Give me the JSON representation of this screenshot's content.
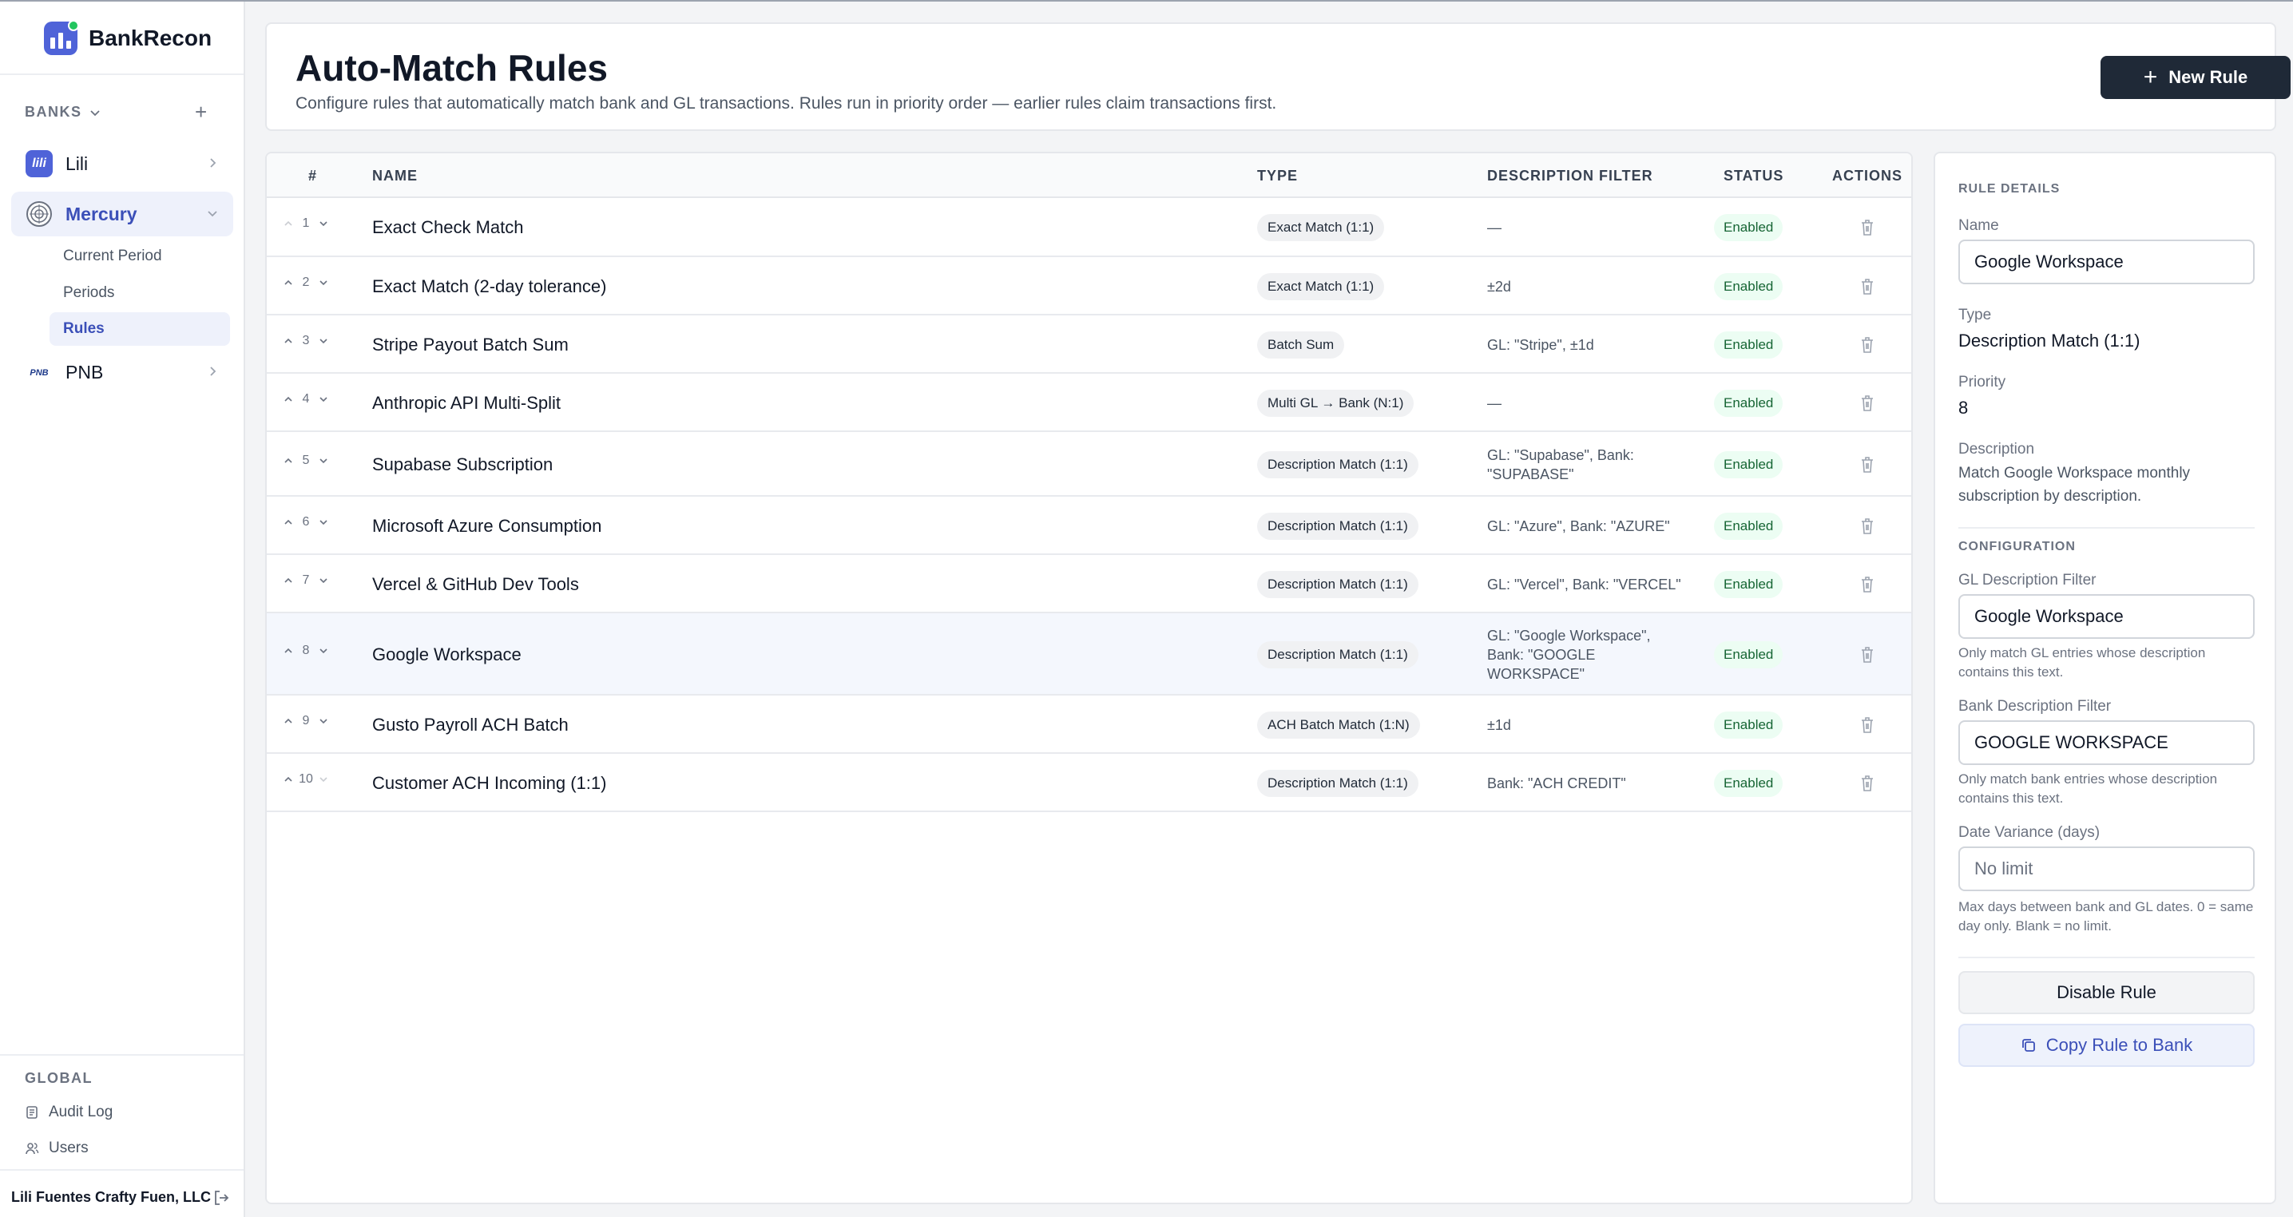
{
  "app": {
    "name": "BankRecon"
  },
  "sidebar": {
    "banks_label": "BANKS",
    "banks": [
      {
        "label": "Lili",
        "icon": "lili-logo-icon",
        "color": "#4f63d8"
      },
      {
        "label": "Mercury",
        "icon": "mercury-logo-icon",
        "color": "#6b7280"
      },
      {
        "label": "PNB",
        "icon": "pnb-logo-icon",
        "color": "#1e3a8a"
      }
    ],
    "mercury_items": [
      "Current Period",
      "Periods",
      "Rules"
    ],
    "global_label": "GLOBAL",
    "global_items": [
      "Audit Log",
      "Users"
    ],
    "org_name": "Lili Fuentes Crafty Fuen, LLC"
  },
  "header": {
    "title": "Auto-Match Rules",
    "subtitle": "Configure rules that automatically match bank and GL transactions. Rules run in priority order — earlier rules claim transactions first.",
    "new_rule_label": "New Rule"
  },
  "table": {
    "columns": {
      "num": "#",
      "name": "NAME",
      "type": "TYPE",
      "filter": "DESCRIPTION FILTER",
      "status": "STATUS",
      "actions": "ACTIONS"
    },
    "rows": [
      {
        "num": "1",
        "name": "Exact Check Match",
        "type": "Exact Match (1:1)",
        "filter": "—",
        "status": "Enabled"
      },
      {
        "num": "2",
        "name": "Exact Match (2-day tolerance)",
        "type": "Exact Match (1:1)",
        "filter": "±2d",
        "status": "Enabled"
      },
      {
        "num": "3",
        "name": "Stripe Payout Batch Sum",
        "type": "Batch Sum",
        "filter": "GL: \"Stripe\", ±1d",
        "status": "Enabled"
      },
      {
        "num": "4",
        "name": "Anthropic API Multi-Split",
        "type": "Multi GL → Bank (N:1)",
        "filter": "—",
        "status": "Enabled"
      },
      {
        "num": "5",
        "name": "Supabase Subscription",
        "type": "Description Match (1:1)",
        "filter": "GL: \"Supabase\", Bank: \"SUPABASE\"",
        "status": "Enabled"
      },
      {
        "num": "6",
        "name": "Microsoft Azure Consumption",
        "type": "Description Match (1:1)",
        "filter": "GL: \"Azure\", Bank: \"AZURE\"",
        "status": "Enabled"
      },
      {
        "num": "7",
        "name": "Vercel & GitHub Dev Tools",
        "type": "Description Match (1:1)",
        "filter": "GL: \"Vercel\", Bank: \"VERCEL\"",
        "status": "Enabled"
      },
      {
        "num": "8",
        "name": "Google Workspace",
        "type": "Description Match (1:1)",
        "filter": "GL: \"Google Workspace\", Bank: \"GOOGLE WORKSPACE\"",
        "status": "Enabled"
      },
      {
        "num": "9",
        "name": "Gusto Payroll ACH Batch",
        "type": "ACH Batch Match (1:N)",
        "filter": "±1d",
        "status": "Enabled"
      },
      {
        "num": "10",
        "name": "Customer ACH Incoming (1:1)",
        "type": "Description Match (1:1)",
        "filter": "Bank: \"ACH CREDIT\"",
        "status": "Enabled"
      }
    ]
  },
  "details": {
    "section_title": "RULE DETAILS",
    "name_label": "Name",
    "name_value": "Google Workspace",
    "type_label": "Type",
    "type_value": "Description Match (1:1)",
    "priority_label": "Priority",
    "priority_value": "8",
    "description_label": "Description",
    "description_value": "Match Google Workspace monthly subscription by description.",
    "config_title": "CONFIGURATION",
    "gl_filter_label": "GL Description Filter",
    "gl_filter_value": "Google Workspace",
    "gl_filter_help": "Only match GL entries whose description contains this text.",
    "bank_filter_label": "Bank Description Filter",
    "bank_filter_value": "GOOGLE WORKSPACE",
    "bank_filter_help": "Only match bank entries whose description contains this text.",
    "variance_label": "Date Variance (days)",
    "variance_placeholder": "No limit",
    "variance_help": "Max days between bank and GL dates. 0 = same day only. Blank = no limit.",
    "disable_label": "Disable Rule",
    "copy_label": "Copy Rule to Bank"
  }
}
